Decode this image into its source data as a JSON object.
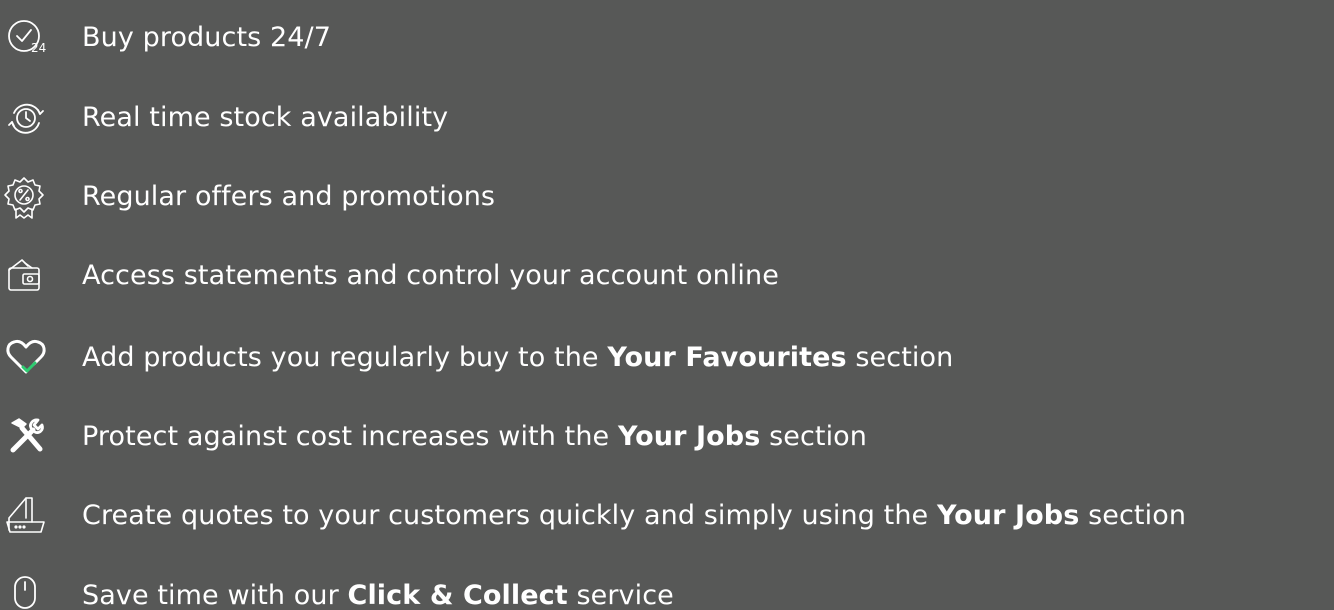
{
  "colors": {
    "background": "#575857",
    "text": "#ffffff",
    "accent": "#2ecc71"
  },
  "features": [
    {
      "icon": "clock-24-icon",
      "text_before": "Buy products 24/7",
      "emphasis": "",
      "text_after": ""
    },
    {
      "icon": "stock-refresh-clock-icon",
      "text_before": "Real time stock availability",
      "emphasis": "",
      "text_after": ""
    },
    {
      "icon": "percent-badge-icon",
      "text_before": "Regular offers and promotions",
      "emphasis": "",
      "text_after": ""
    },
    {
      "icon": "wallet-icon",
      "text_before": "Access statements and control your account online",
      "emphasis": "",
      "text_after": ""
    },
    {
      "icon": "heart-check-icon",
      "text_before": "Add products you regularly buy to the ",
      "emphasis": "Your Favourites",
      "text_after": " section"
    },
    {
      "icon": "tools-icon",
      "text_before": "Protect against cost increases with the ",
      "emphasis": "Your Jobs",
      "text_after": " section"
    },
    {
      "icon": "laptop-quote-icon",
      "text_before": "Create quotes to your customers quickly and simply using the ",
      "emphasis": "Your Jobs",
      "text_after": " section"
    },
    {
      "icon": "mouse-icon",
      "text_before": "Save time with our ",
      "emphasis": "Click & Collect",
      "text_after": " service"
    }
  ]
}
